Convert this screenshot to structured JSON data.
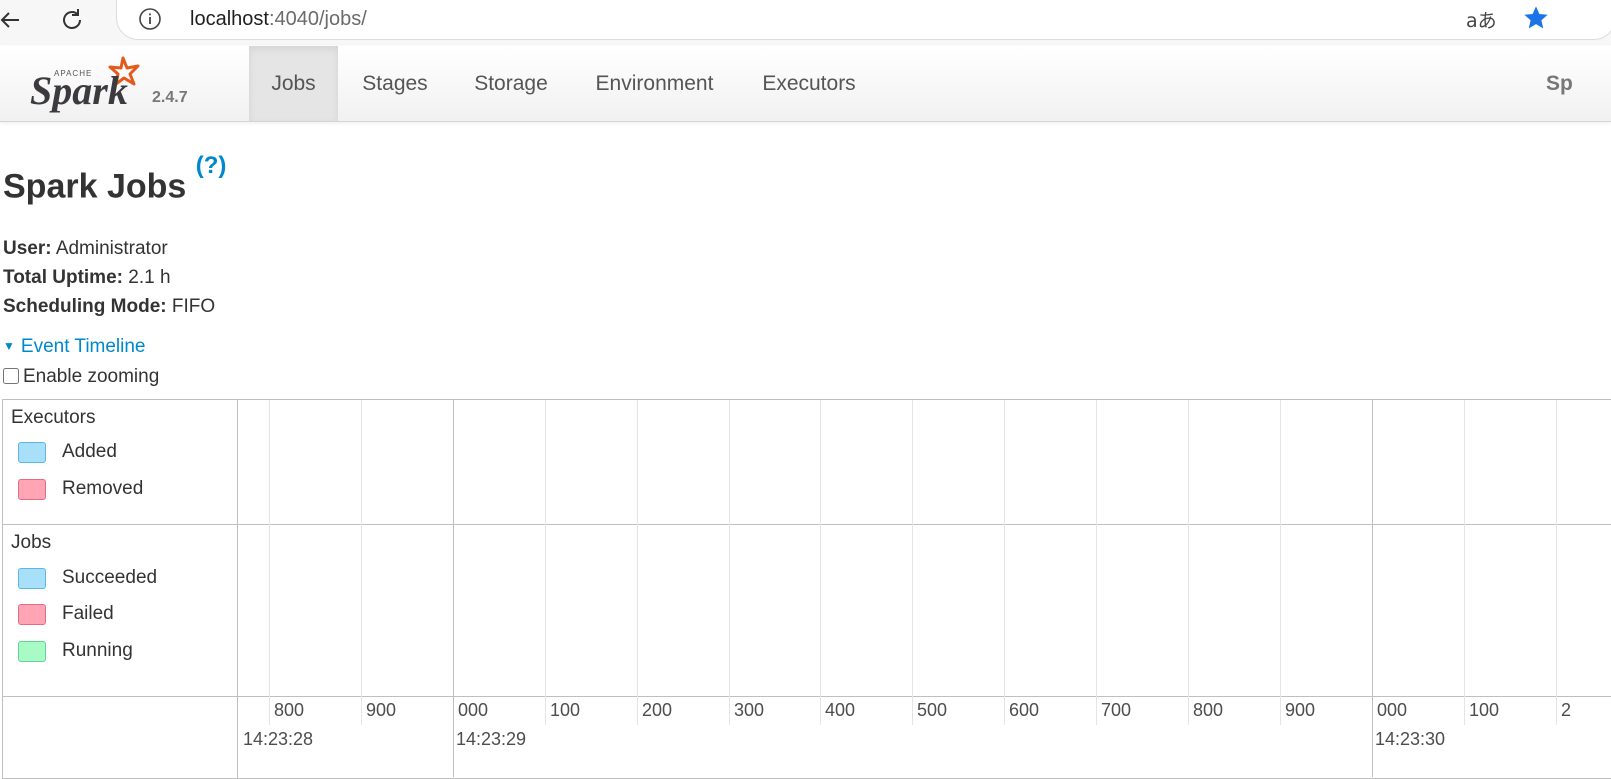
{
  "browser": {
    "url_host": "localhost",
    "url_path": ":4040/jobs/",
    "translate_glyph": "aあ"
  },
  "navbar": {
    "version": "2.4.7",
    "tabs": [
      {
        "label": "Jobs",
        "active": true
      },
      {
        "label": "Stages",
        "active": false
      },
      {
        "label": "Storage",
        "active": false
      },
      {
        "label": "Environment",
        "active": false
      },
      {
        "label": "Executors",
        "active": false
      }
    ],
    "app_name_partial": "Sp"
  },
  "page": {
    "title": "Spark Jobs",
    "help_link": "(?)",
    "summary": {
      "user_label": "User:",
      "user_value": "Administrator",
      "uptime_label": "Total Uptime:",
      "uptime_value": "2.1 h",
      "mode_label": "Scheduling Mode:",
      "mode_value": "FIFO"
    },
    "timeline_toggle": "Event Timeline",
    "enable_zooming_label": "Enable zooming",
    "enable_zooming_checked": false
  },
  "timeline": {
    "executors_group": {
      "title": "Executors",
      "legend": [
        {
          "label": "Added",
          "color": "#a8e0fa"
        },
        {
          "label": "Removed",
          "color": "#ffa5b4"
        }
      ]
    },
    "jobs_group": {
      "title": "Jobs",
      "legend": [
        {
          "label": "Succeeded",
          "color": "#a8e0fa"
        },
        {
          "label": "Failed",
          "color": "#ffa5b4"
        },
        {
          "label": "Running",
          "color": "#a8fac6"
        }
      ]
    },
    "minor_ticks": [
      "800",
      "900",
      "000",
      "100",
      "200",
      "300",
      "400",
      "500",
      "600",
      "700",
      "800",
      "900",
      "000",
      "100",
      "2"
    ],
    "major_ticks": [
      "14:23:28",
      "14:23:29",
      "14:23:30"
    ]
  },
  "colors": {
    "link": "#0088cc",
    "star": "#1a73e8",
    "spark_orange": "#e25a1c"
  }
}
